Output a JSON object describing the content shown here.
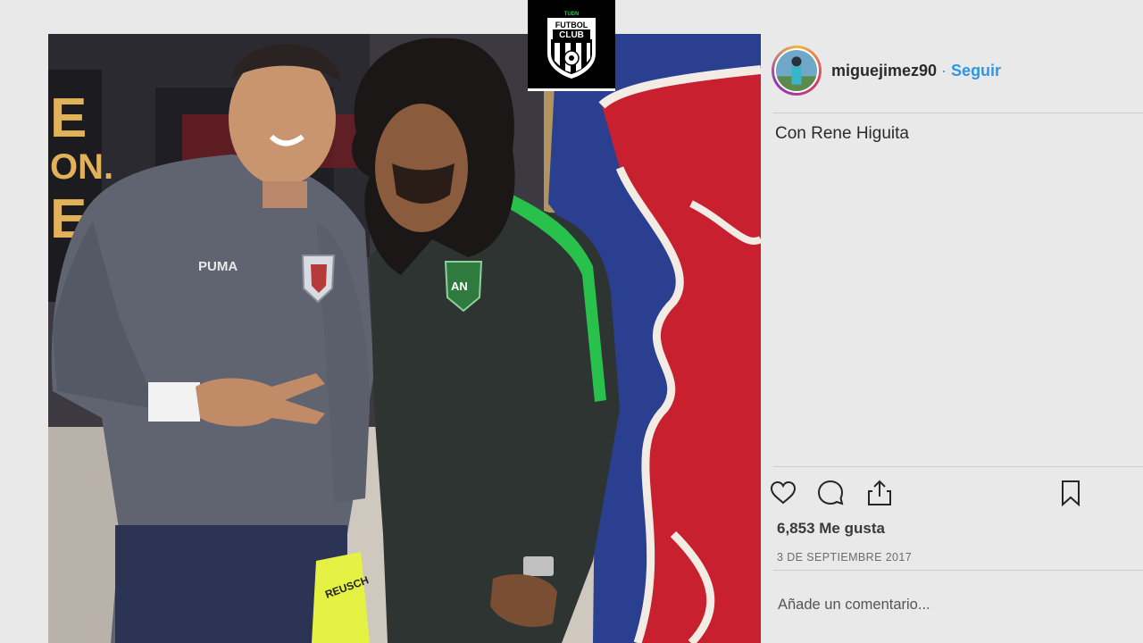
{
  "post": {
    "username": "miguejimez90",
    "separator": "·",
    "follow_label": "Seguir",
    "caption": "Con Rene Higuita",
    "likes": "6,853 Me gusta",
    "date": "3 DE SEPTIEMBRE 2017",
    "comment_placeholder": "Añade un comentario..."
  },
  "channel_logo": {
    "top_text": "TUDN",
    "line1": "FUTBOL",
    "line2": "CLUB"
  },
  "photo_text": {
    "left_sign_letters": [
      "E",
      "ON.",
      "E"
    ],
    "jersey_brand": "PUMA",
    "glove_text": "REUSCH",
    "crest_text": "AN"
  },
  "icons": {
    "like": "heart-icon",
    "comment": "comment-bubble-icon",
    "share": "share-icon",
    "save": "bookmark-icon"
  },
  "colors": {
    "background": "#e9e9ea",
    "follow_blue": "#2f96e6",
    "text_dark": "#262626",
    "divider": "#cfcfcf",
    "jersey_grey": "#5f6470",
    "jacket_dark": "#2e3431",
    "jacket_green": "#27c14b",
    "wall_blue": "#2a3f8f",
    "bull_red": "#c8202e"
  }
}
